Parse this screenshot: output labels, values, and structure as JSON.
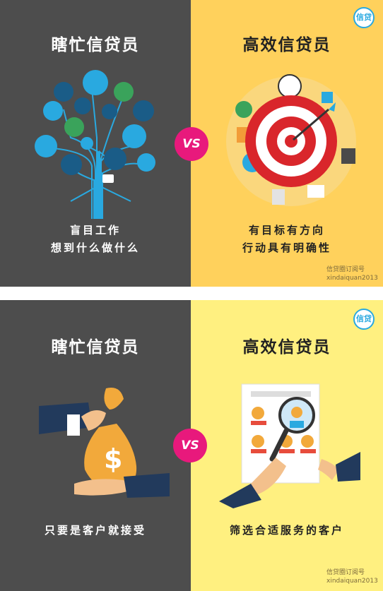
{
  "panel1": {
    "left_title": "瞎忙信贷员",
    "right_title": "高效信贷员",
    "vs": "VS",
    "logo": "信贷",
    "left_caption_line1": "盲目工作",
    "left_caption_line2": "想到什么做什么",
    "right_caption_line1": "有目标有方向",
    "right_caption_line2": "行动具有明确性",
    "watermark_line1": "信贷圈订阅号",
    "watermark_line2": "xindaiquan2013"
  },
  "panel2": {
    "left_title": "瞎忙信贷员",
    "right_title": "高效信贷员",
    "vs": "VS",
    "logo": "信贷",
    "left_caption": "只要是客户就接受",
    "right_caption": "筛选合适服务的客户",
    "watermark_line1": "信贷圈订阅号",
    "watermark_line2": "xindaiquan2013"
  },
  "colors": {
    "dark_bg": "#4d4d4d",
    "yellow_bg": "#ffd15c",
    "light_yellow_bg": "#fff080",
    "vs_pink": "#e8197c",
    "accent_blue": "#29a9e0",
    "target_red": "#d9262b"
  }
}
